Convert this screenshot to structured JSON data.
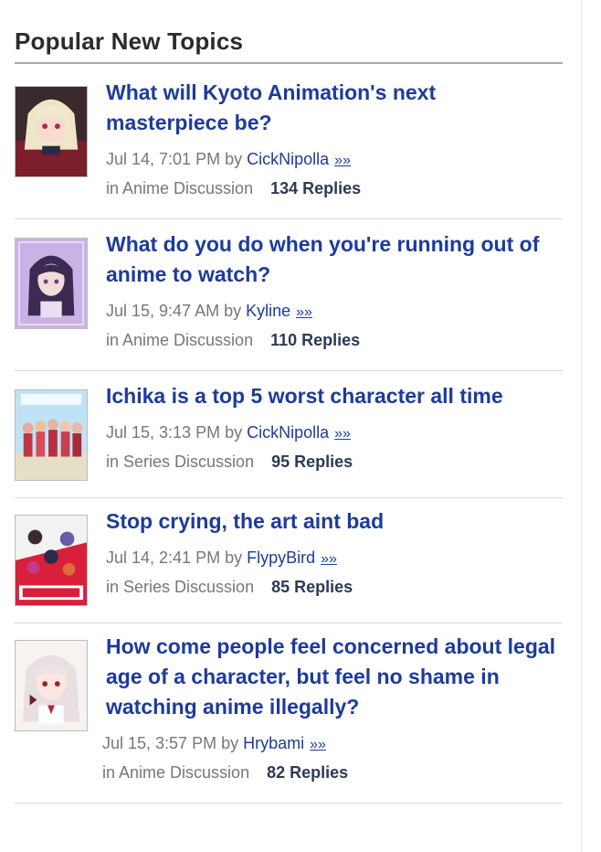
{
  "panel": {
    "title": "Popular New Topics"
  },
  "topics": [
    {
      "title": "What will Kyoto Animation's next masterpiece be?",
      "date": "Jul 14, 7:01 PM",
      "by": "by",
      "user": "CickNipolla",
      "more": "»»",
      "forum_prefix": "in",
      "forum": "Anime Discussion",
      "replies": "134 Replies"
    },
    {
      "title": "What do you do when you're running out of anime to watch?",
      "date": "Jul 15, 9:47 AM",
      "by": "by",
      "user": "Kyline",
      "more": "»»",
      "forum_prefix": "in",
      "forum": "Anime Discussion",
      "replies": "110 Replies"
    },
    {
      "title": "Ichika is a top 5 worst character all time",
      "date": "Jul 15, 3:13 PM",
      "by": "by",
      "user": "CickNipolla",
      "more": "»»",
      "forum_prefix": "in",
      "forum": "Series Discussion",
      "replies": "95 Replies"
    },
    {
      "title": "Stop crying, the art aint bad",
      "date": "Jul 14, 2:41 PM",
      "by": "by",
      "user": "FlypyBird",
      "more": "»»",
      "forum_prefix": "in",
      "forum": "Series Discussion",
      "replies": "85 Replies"
    },
    {
      "title": "How come people feel concerned about legal age of a character, but feel no shame in watching anime illegally?",
      "date": "Jul 15, 3:57 PM",
      "by": "by",
      "user": "Hrybami",
      "more": "»»",
      "forum_prefix": "in",
      "forum": "Anime Discussion",
      "replies": "82 Replies"
    }
  ]
}
